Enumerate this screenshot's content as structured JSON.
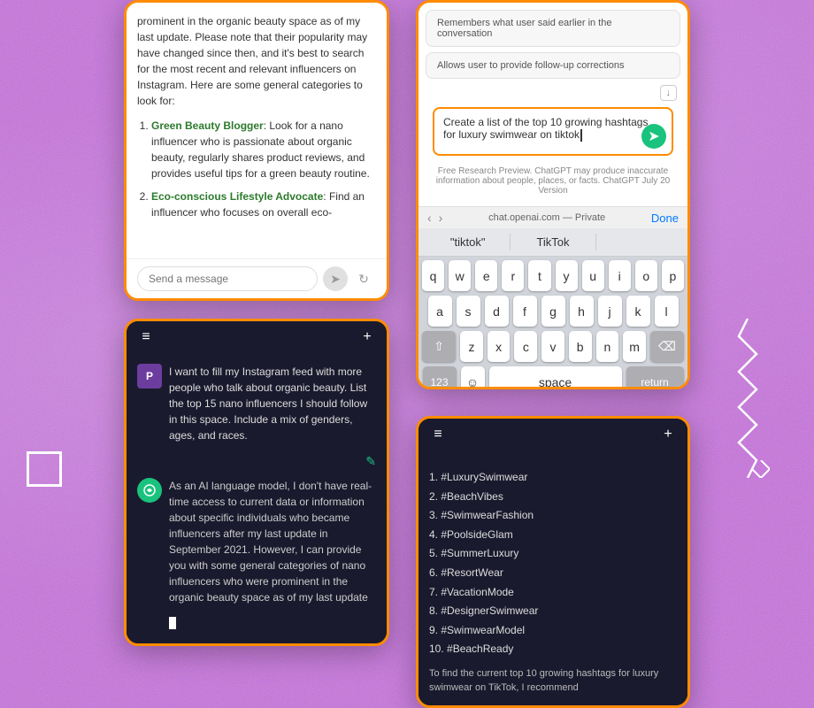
{
  "background": {
    "color": "#c86de0"
  },
  "phone_top_left": {
    "chat_text_1": "prominent in the organic beauty space as of my last update. Please note that their popularity may have changed since then, and it's best to search for the most recent and relevant influencers on Instagram. Here are some general categories to look for:",
    "list_item_1_title": "Green Beauty Blogger",
    "list_item_1_text": ": Look for a nano influencer who is passionate about organic beauty, regularly shares product reviews, and provides useful tips for a green beauty routine.",
    "list_item_2_title": "Eco-conscious Lifestyle Advocate",
    "list_item_2_text": ": Find an influencer who focuses on overall eco-",
    "input_placeholder": "Send a message"
  },
  "phone_bottom_left": {
    "header_menu_icon": "≡",
    "header_plus_icon": "+",
    "user_message": "I want to fill my Instagram feed with more people who talk about organic beauty. List the top 15 nano influencers I should follow in this space. Include a mix of genders, ages, and races.",
    "ai_message": "As an AI language model, I don't have real-time access to current data or information about specific individuals who became influencers after my last update in September 2021. However, I can provide you with some general categories of nano influencers who were prominent in the organic beauty space as of my last update"
  },
  "phone_top_right": {
    "feature_1": "Remembers what user said earlier in the conversation",
    "feature_2": "Allows user to provide follow-up corrections",
    "input_text": "Create a list of the top 10 growing hashtags for luxury swimwear on tiktok",
    "disclaimer_text": "Free Research Preview. ChatGPT may produce inaccurate information about people, places, or facts.",
    "disclaimer_link": "ChatGPT July 20 Version",
    "url": "chat.openai.com — Private",
    "done_label": "Done",
    "suggestion_1": "\"tiktok\"",
    "suggestion_2": "TikTok",
    "keyboard_rows": [
      [
        "q",
        "w",
        "e",
        "r",
        "t",
        "y",
        "u",
        "i",
        "o",
        "p"
      ],
      [
        "a",
        "s",
        "d",
        "f",
        "g",
        "h",
        "j",
        "k",
        "l"
      ],
      [
        "z",
        "x",
        "c",
        "v",
        "b",
        "n",
        "m"
      ]
    ],
    "key_123": "123",
    "key_space": "space",
    "key_return": "return"
  },
  "phone_bottom_right": {
    "header_menu_icon": "≡",
    "header_plus_icon": "+",
    "hashtags": [
      "1.  #LuxurySwimwear",
      "2.  #BeachVibes",
      "3.  #SwimwearFashion",
      "4.  #PoolsideGlam",
      "5.  #SummerLuxury",
      "6.  #ResortWear",
      "7.  #VacationMode",
      "8.  #DesignerSwimwear",
      "9.  #SwimwearModel",
      "10. #BeachReady"
    ],
    "bottom_text": "To find the current top 10 growing hashtags for luxury swimwear on TikTok, I recommend"
  },
  "decorations": {
    "zigzag_color": "#fff",
    "box_color": "#fff"
  }
}
